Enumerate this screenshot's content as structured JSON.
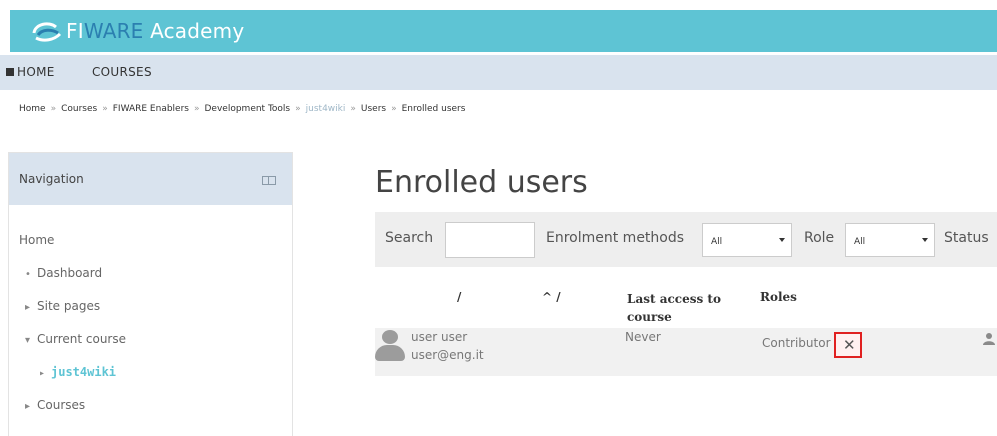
{
  "brand": {
    "logo_prefix": "FI",
    "logo_ware": "WARE",
    "logo_suffix": " Academy"
  },
  "navbar": {
    "items": [
      {
        "label": "HOME",
        "icon": "home-icon"
      },
      {
        "label": "COURSES"
      }
    ]
  },
  "breadcrumb": [
    "Home",
    "Courses",
    "FIWARE Enablers",
    "Development Tools",
    "just4wiki",
    "Users",
    "Enrolled users"
  ],
  "breadcrumb_separator": "»",
  "navigation": {
    "title": "Navigation",
    "items": [
      {
        "label": "Home",
        "bullet": ""
      },
      {
        "label": "Dashboard",
        "bullet": "•"
      },
      {
        "label": "Site pages",
        "bullet": "▸"
      },
      {
        "label": "Current course",
        "bullet": "▾"
      },
      {
        "label": "just4wiki",
        "bullet": "▸"
      },
      {
        "label": "Courses",
        "bullet": "▸"
      }
    ]
  },
  "main": {
    "title": "Enrolled users",
    "filters": {
      "search_label": "Search",
      "search_value": "",
      "enrolment_label": "Enrolment methods",
      "enrolment_value": "All",
      "role_label": "Role",
      "role_value": "All",
      "status_label": "Status"
    },
    "table": {
      "headers": [
        "/",
        "^ /",
        "Last access to course",
        "Roles"
      ],
      "rows": [
        {
          "name": "user user",
          "email": "user@eng.it",
          "last_access": "Never",
          "role": "Contributor",
          "remove_glyph": "✕",
          "action_icon": "person-icon"
        }
      ]
    }
  },
  "colors": {
    "brand": "#5ec4d4",
    "nav_bg": "#d9e3ee",
    "highlight": "#e02020"
  }
}
